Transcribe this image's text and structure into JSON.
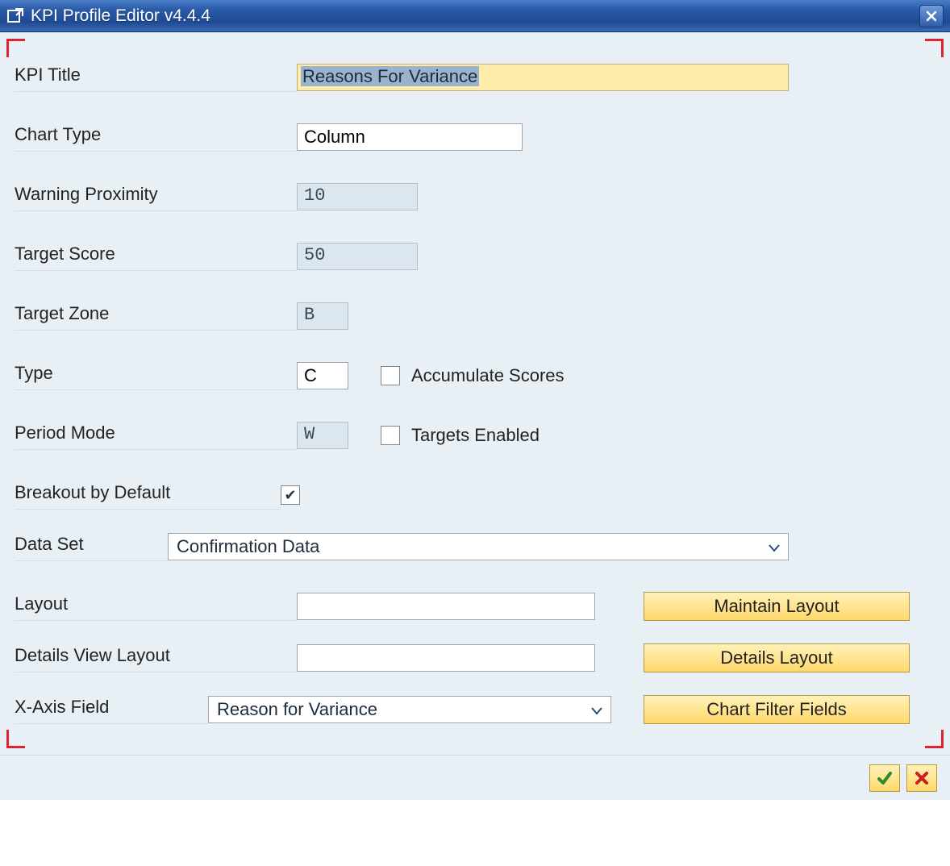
{
  "window": {
    "title": "KPI Profile Editor v4.4.4"
  },
  "fields": {
    "kpi_title_label": "KPI Title",
    "kpi_title_value": "Reasons For Variance",
    "chart_type_label": "Chart Type",
    "chart_type_value": "Column",
    "warning_prox_label": "Warning Proximity",
    "warning_prox_value": "10",
    "target_score_label": "Target Score",
    "target_score_value": "50",
    "target_zone_label": "Target Zone",
    "target_zone_value": "B",
    "type_label": "Type",
    "type_value": "C",
    "accumulate_label": "Accumulate Scores",
    "period_mode_label": "Period Mode",
    "period_mode_value": "W",
    "targets_enabled_label": "Targets Enabled",
    "breakout_label": "Breakout by Default",
    "data_set_label": "Data Set",
    "data_set_value": "Confirmation Data",
    "layout_label": "Layout",
    "layout_value": "",
    "details_layout_label": "Details View Layout",
    "details_layout_value": "",
    "x_axis_label": "X-Axis Field",
    "x_axis_value": "Reason for Variance"
  },
  "buttons": {
    "maintain_layout": "Maintain Layout",
    "details_layout": "Details Layout",
    "chart_filter_fields": "Chart Filter Fields"
  },
  "checkboxes": {
    "accumulate_scores": false,
    "targets_enabled": false,
    "breakout_default": true
  }
}
